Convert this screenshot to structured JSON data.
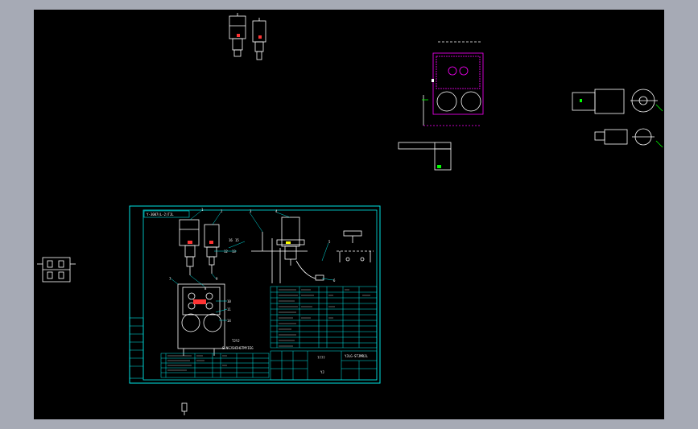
{
  "app": {
    "background": "#a6aab5",
    "canvas_color": "#000000"
  },
  "colors": {
    "frame": "#00e5e5",
    "part": "#ffffff",
    "highlight": "#ff00ff",
    "accent": "#ffff00",
    "leader": "#00ff00",
    "annotation": "#ff3333"
  },
  "drawing": {
    "title_text": "Y-3007(L-2)TJL",
    "caption_center": "TJYJ",
    "caption_sub": "SLNGJSHIHGTMYIEG",
    "summary_mark": "????",
    "titleblock_name": "YJLG-STJMRJL",
    "titleblock_sub": "YJ",
    "balloons": [
      "1",
      "2",
      "3",
      "4",
      "5",
      "6",
      "7",
      "8",
      "9",
      "10",
      "11",
      "12",
      "13",
      "14",
      "15",
      "16"
    ]
  }
}
